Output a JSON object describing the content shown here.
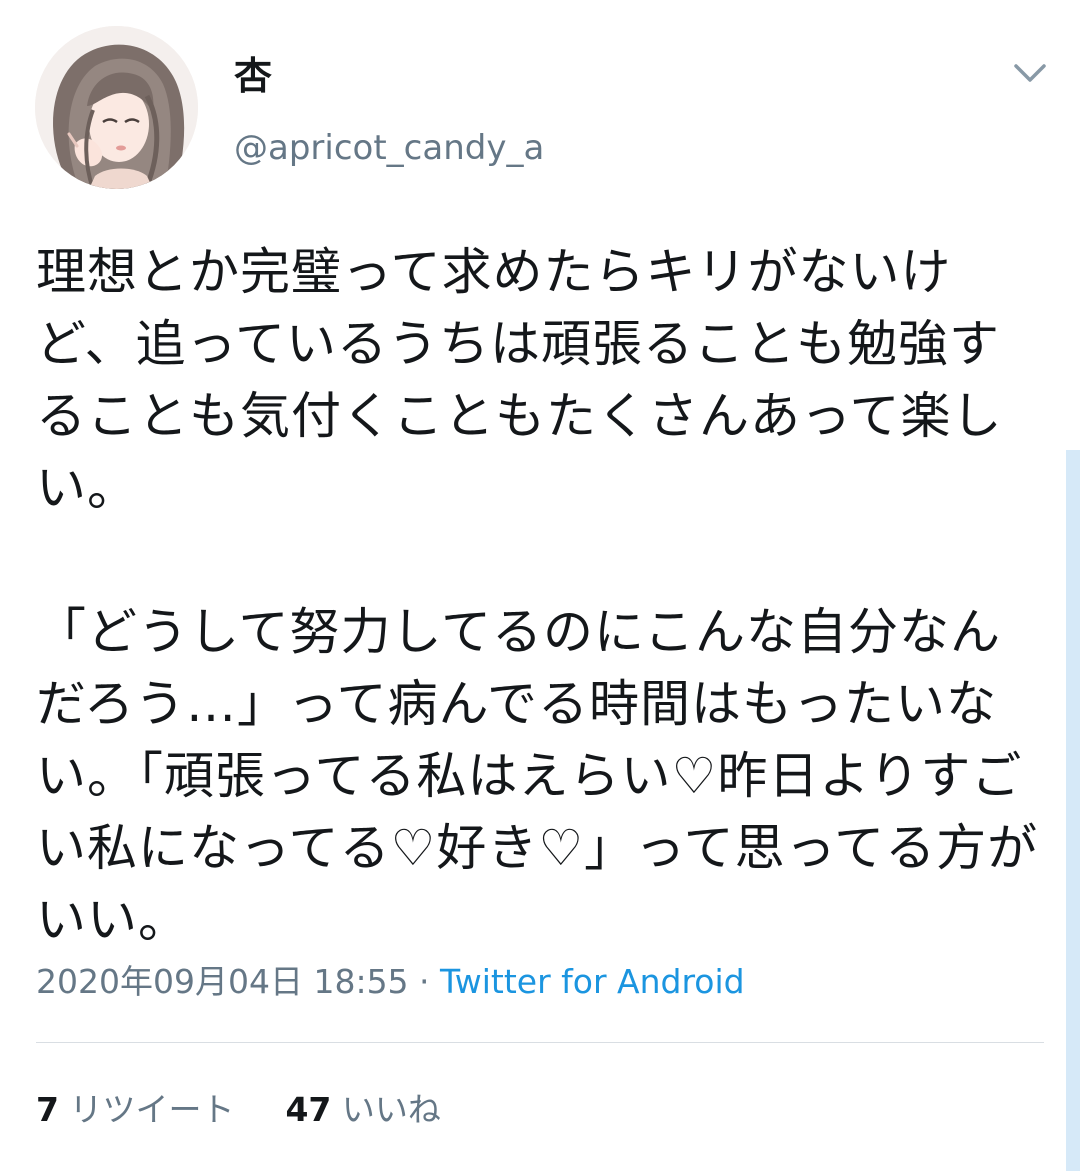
{
  "user": {
    "display_name": "杏",
    "handle": "@apricot_candy_a"
  },
  "tweet": {
    "paragraphs": [
      "理想とか完璧って求めたらキリがないけど、追っているうちは頑張ることも勉強することも気付くこともたくさんあって楽しい。",
      "「どうして努力してるのにこんな自分なんだろう…」って病んでる時間はもったいない。「頑張ってる私はえらい♡昨日よりすごい私になってる♡好き♡」って思ってる方がいい。"
    ],
    "timestamp": "2020年09月04日 18:55",
    "separator": " · ",
    "source": "Twitter for Android"
  },
  "stats": {
    "retweets_count": "7",
    "retweets_label": "リツイート",
    "likes_count": "47",
    "likes_label": "いいね"
  },
  "colors": {
    "text": "#14171a",
    "secondary": "#657786",
    "link": "#1b95e0",
    "divider": "#d9dee3"
  },
  "icons": {
    "menu": "chevron-down-icon"
  }
}
